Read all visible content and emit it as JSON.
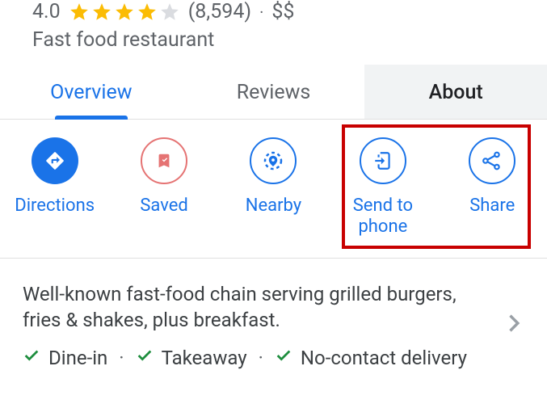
{
  "header": {
    "rating": "4.0",
    "reviews_count": "(8,594)",
    "price": "$$",
    "separator": "·",
    "subtype": "Fast food restaurant"
  },
  "tabs": {
    "overview": "Overview",
    "reviews": "Reviews",
    "about": "About"
  },
  "actions": {
    "directions": "Directions",
    "saved": "Saved",
    "nearby": "Nearby",
    "send_to_phone": "Send to phone",
    "share": "Share"
  },
  "description": {
    "summary": "Well-known fast-food chain serving grilled burgers, fries & shakes, plus breakfast.",
    "services": {
      "dine_in": "Dine-in",
      "takeaway": "Takeaway",
      "no_contact": "No-contact delivery",
      "sep": "·"
    }
  }
}
